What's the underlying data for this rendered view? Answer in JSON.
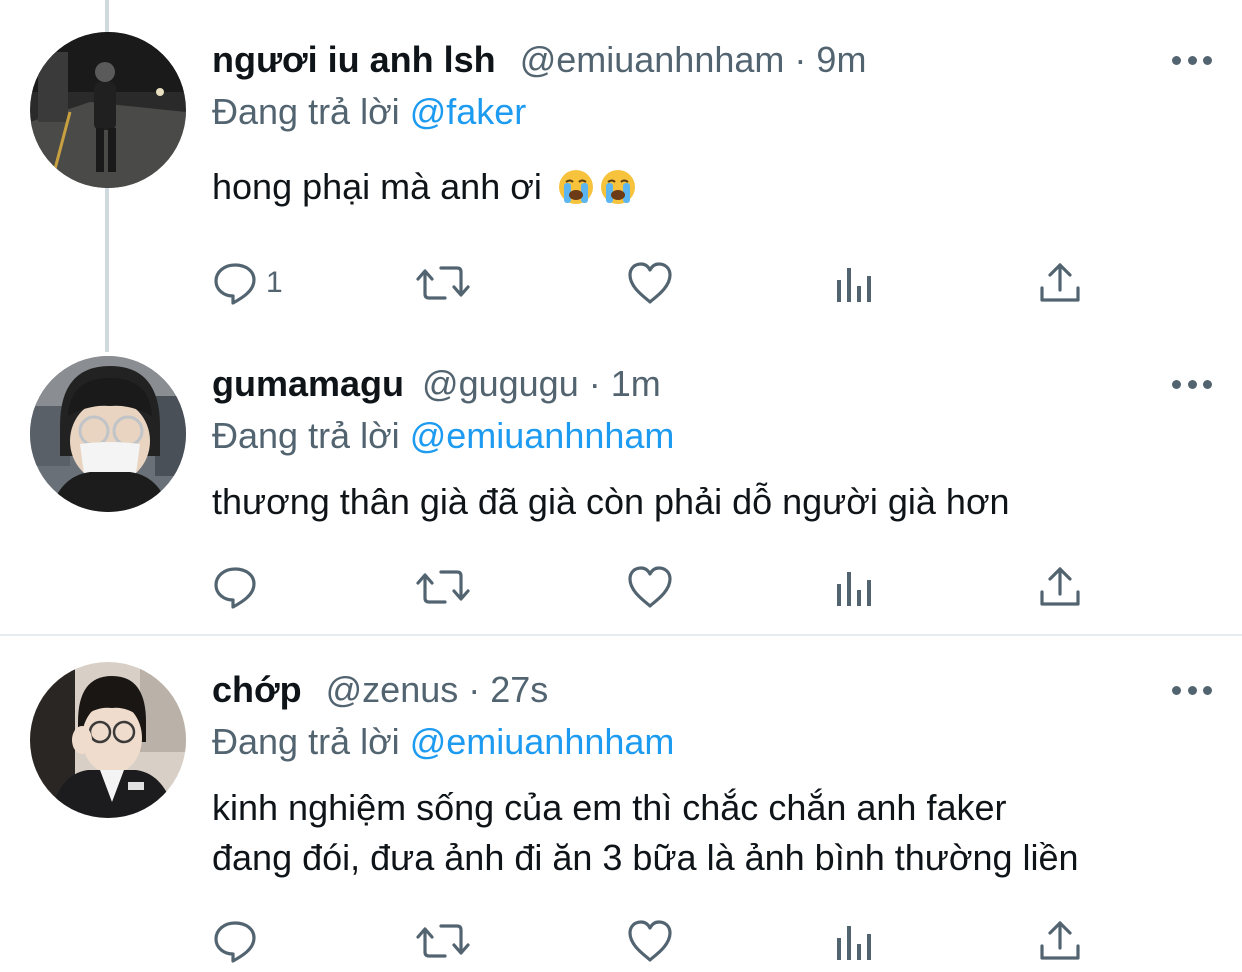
{
  "tweets": [
    {
      "name": "ngươi iu anh lsh",
      "handle": "@emiuanhnham",
      "separator": "·",
      "time": "9m",
      "replying_prefix": "Đang trả lời",
      "replying_to": "@faker",
      "text": "hong phại mà anh ơi",
      "emojis": [
        "loudly-crying-face-icon",
        "loudly-crying-face-icon"
      ],
      "reply_count": "1"
    },
    {
      "name": "gumamagu",
      "handle": "@gugugu",
      "separator": "·",
      "time": "1m",
      "replying_prefix": "Đang trả lời",
      "replying_to": "@emiuanhnham",
      "text": "thương thân già đã già còn phải dỗ người già hơn",
      "reply_count": ""
    },
    {
      "name": "chớp",
      "handle": "@zenus",
      "separator": "·",
      "time": "27s",
      "replying_prefix": "Đang trả lời",
      "replying_to": "@emiuanhnham",
      "text_line1": "kinh nghiệm sống của em thì chắc chắn anh faker",
      "text_line2": "đang đói, đưa ảnh đi ăn 3 bữa là ảnh bình thường liền",
      "reply_count": ""
    }
  ],
  "colors": {
    "text": "#0f1419",
    "secondary": "#536471",
    "link": "#1d9bf0",
    "thread_line": "#cfd9de",
    "divider": "#e6ecf0"
  },
  "icons": {
    "reply": "comment-bubble-icon",
    "retweet": "retweet-icon",
    "like": "heart-icon",
    "views": "bar-chart-icon",
    "share": "share-upload-icon",
    "more": "more-dots-icon"
  }
}
